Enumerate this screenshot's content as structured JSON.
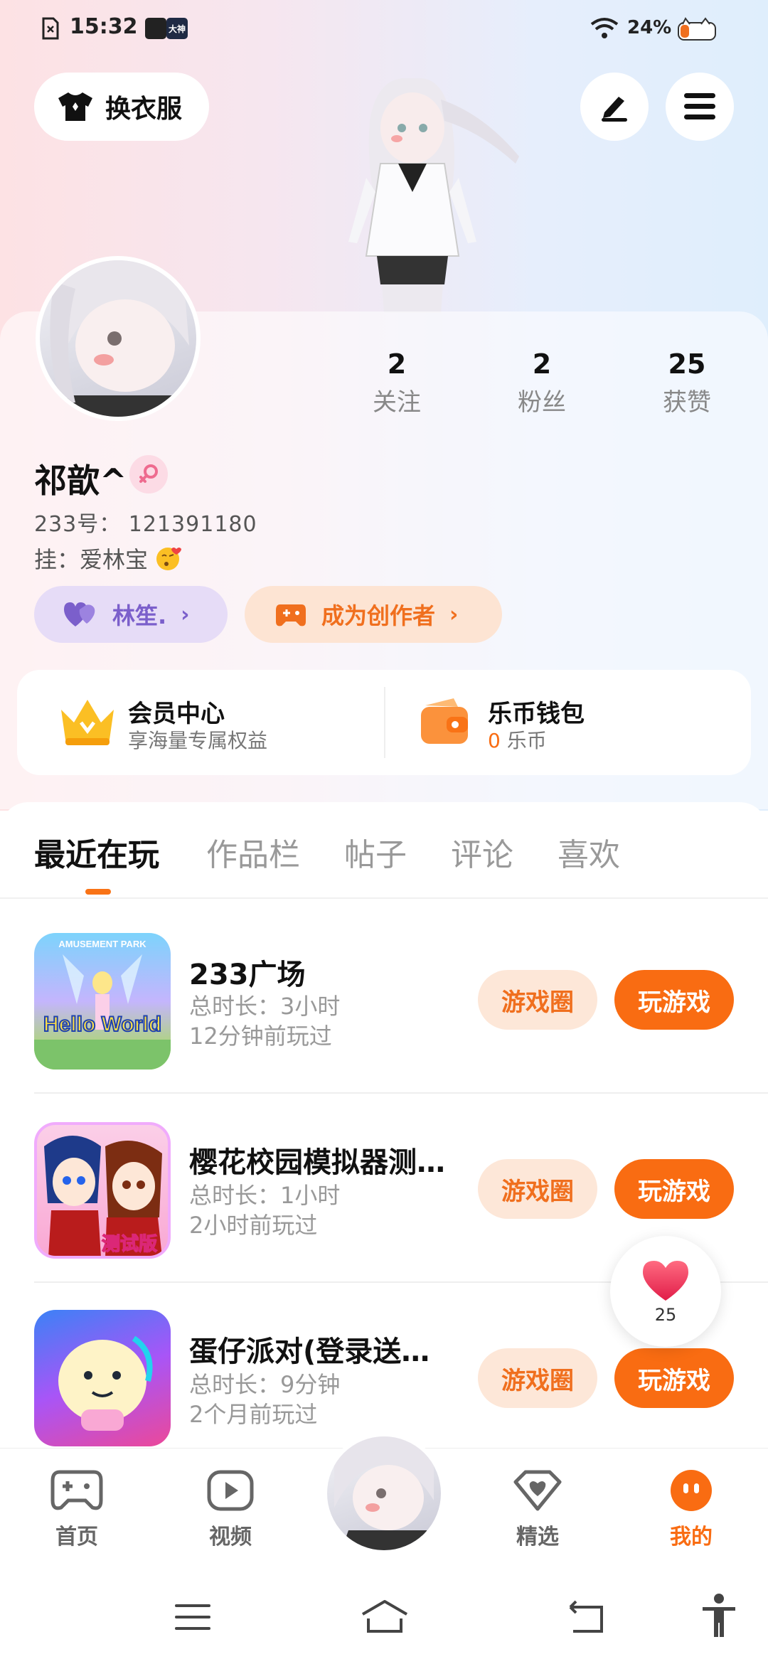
{
  "status_bar": {
    "time": "15:32",
    "battery": "24%",
    "icon_labels": [
      "大神"
    ]
  },
  "header": {
    "outfit_label": "换衣服"
  },
  "profile": {
    "stats": [
      {
        "num": "2",
        "label": "关注"
      },
      {
        "num": "2",
        "label": "粉丝"
      },
      {
        "num": "25",
        "label": "获赞"
      }
    ],
    "username": "祁歆^",
    "uid": "233号： 121391180",
    "signature": "挂：爱林宝",
    "tag_friend": "林笙.",
    "tag_creator": "成为创作者"
  },
  "member": {
    "title": "会员中心",
    "subtitle": "享海量专属权益"
  },
  "wallet": {
    "title": "乐币钱包",
    "amount": "0",
    "unit": "乐币"
  },
  "tabs": [
    "最近在玩",
    "作品栏",
    "帖子",
    "评论",
    "喜欢"
  ],
  "games": [
    {
      "name": "233广场",
      "duration": "总时长：3小时",
      "last_played": "12分钟前玩过",
      "thumb_text": "Hello World",
      "thumb_top": "AMUSEMENT PARK"
    },
    {
      "name": "樱花校园模拟器测…",
      "duration": "总时长：1小时",
      "last_played": "2小时前玩过",
      "thumb_text": "测试版"
    },
    {
      "name": "蛋仔派对(登录送…",
      "duration": "总时长：9分钟",
      "last_played": "2个月前玩过"
    }
  ],
  "game_buttons": {
    "circle": "游戏圈",
    "play": "玩游戏"
  },
  "like_count": "25",
  "bottom_nav": [
    {
      "label": "首页"
    },
    {
      "label": "视频"
    },
    {
      "label": "精选"
    },
    {
      "label": "我的"
    }
  ],
  "colors": {
    "accent": "#f96c12",
    "purple": "#7b5fcb"
  }
}
